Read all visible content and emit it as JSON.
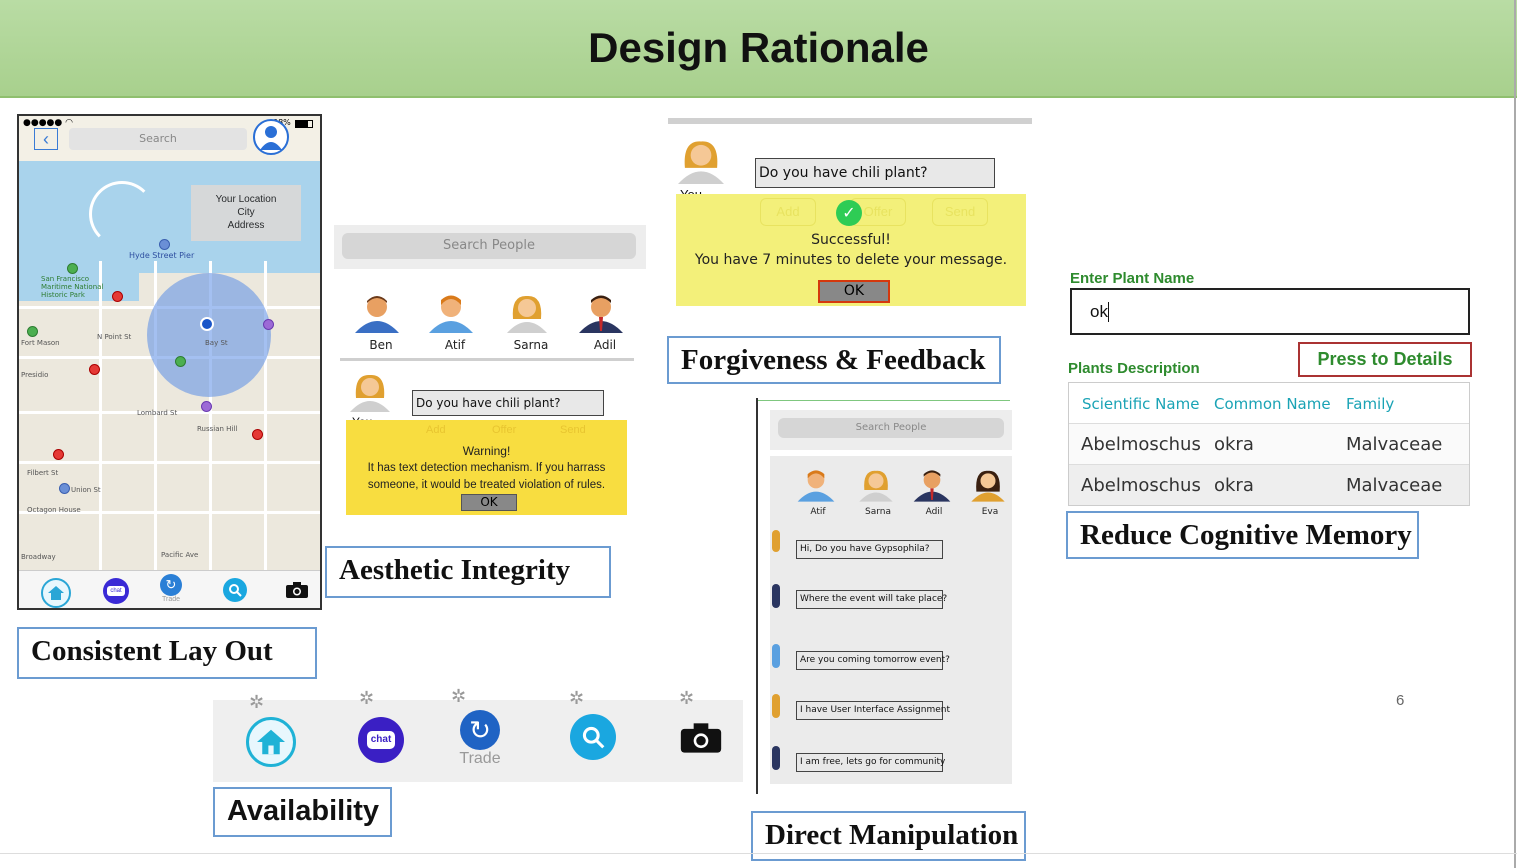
{
  "slide": {
    "title": "Design Rationale",
    "page_number": "6"
  },
  "captions": {
    "consistent_layout": "Consistent Lay Out",
    "aesthetic_integrity": "Aesthetic Integrity",
    "forgiveness_feedback": "Forgiveness & Feedback",
    "reduce_cognitive_memory": "Reduce Cognitive Memory",
    "availability": "Availability",
    "direct_manipulation": "Direct Manipulation"
  },
  "map_screen": {
    "search_placeholder": "Search",
    "battery": "98%",
    "location_tooltip": [
      "Your Location",
      "City",
      "Address"
    ],
    "map_labels": [
      "Hyde Street Pier",
      "San Francisco Maritime National Historic Park",
      "Fort Mason",
      "Presidio",
      "Octagon House",
      "Union St",
      "Filbert St",
      "Russian Hill",
      "Lombard St",
      "Bay St",
      "N Point St",
      "Pacific Ave",
      "Broadway"
    ],
    "tabs": [
      "home",
      "chat",
      "Trade",
      "search",
      "camera"
    ]
  },
  "people_screen": {
    "search_placeholder": "Search People",
    "people": [
      "Ben",
      "Atif",
      "Sarna",
      "Adil"
    ],
    "you_label": "You",
    "message": "Do you have chili plant?",
    "faded_buttons": [
      "Add",
      "Offer",
      "Send"
    ],
    "warning_title": "Warning!",
    "warning_text": "It has text detection mechanism. If you harrass someone, it would be treated violation of rules.",
    "ok": "OK"
  },
  "feedback_screen": {
    "you_label": "You",
    "message": "Do you have chili plant?",
    "faded_buttons": [
      "Add",
      "Offer",
      "Send"
    ],
    "success_title": "Successful!",
    "success_text": "You have 7 minutes to delete your message.",
    "ok": "OK"
  },
  "direct_screen": {
    "search_placeholder": "Search People",
    "people": [
      "Atif",
      "Sarna",
      "Adil",
      "Eva"
    ],
    "messages": [
      "Hi, Do you have Gypsophila?",
      "Where the event will take place?",
      "Are you coming tomorrow event?",
      "I have User Interface Assignment",
      "I am free, lets go for community"
    ]
  },
  "plant_form": {
    "label": "Enter Plant Name",
    "value": "ok",
    "description_label": "Plants Description",
    "details_button": "Press to Details",
    "columns": [
      "Scientific Name",
      "Common Name",
      "Family"
    ],
    "rows": [
      [
        "Abelmoschus",
        "okra",
        "Malvaceae"
      ],
      [
        "Abelmoschus",
        "okra",
        "Malvaceae"
      ]
    ]
  },
  "availability_bar": {
    "trade_label": "Trade",
    "chat_label": "chat"
  },
  "colors": {
    "header_green": "#a8d08d",
    "caption_border": "#6b9bd1",
    "warning_yellow": "#f8dd40",
    "success_yellow": "#f3f07a",
    "teal_text": "#1aa3b5",
    "form_green": "#2e8b2e"
  }
}
